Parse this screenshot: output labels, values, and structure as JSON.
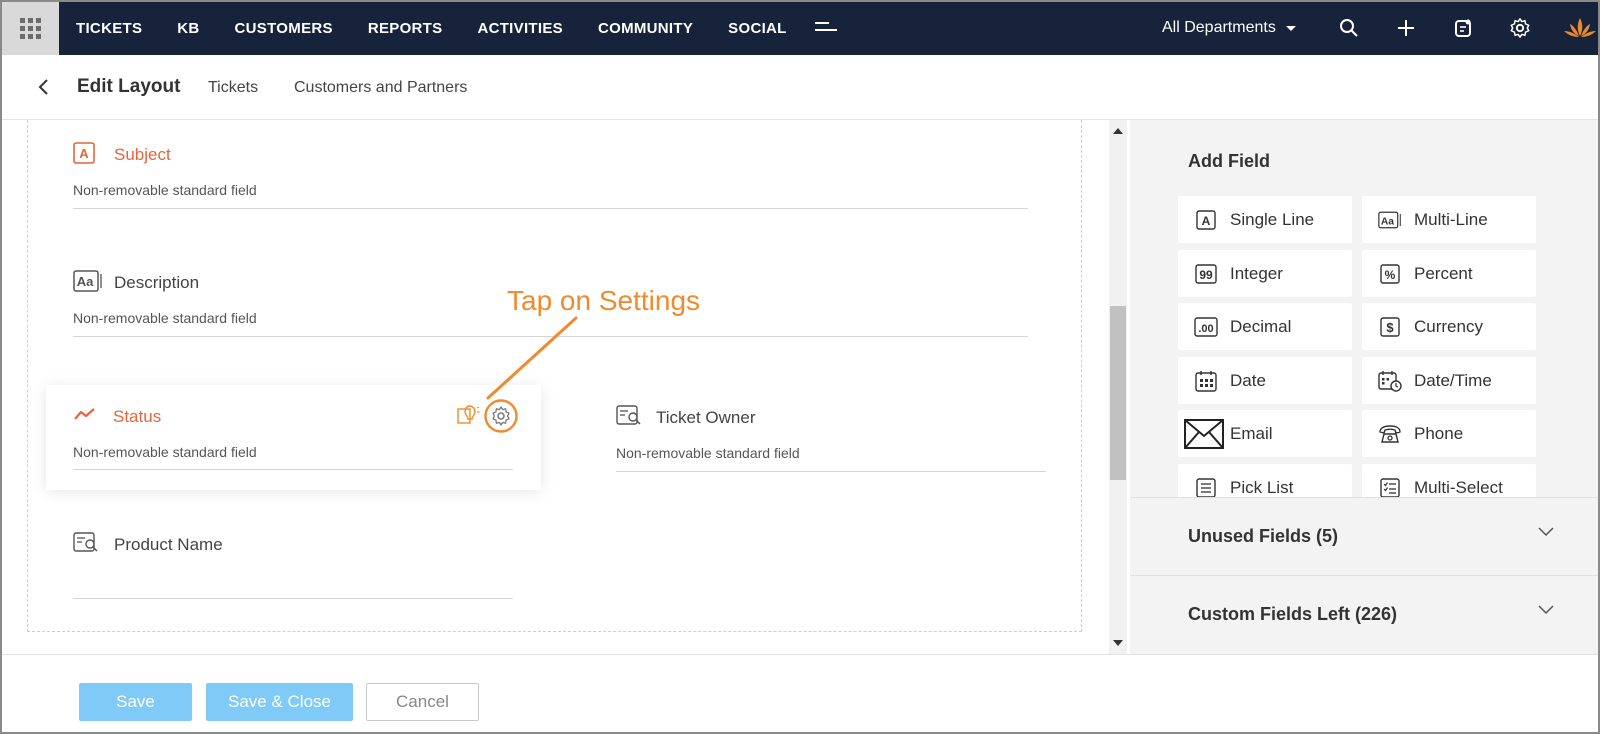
{
  "topnav": {
    "items": [
      "TICKETS",
      "KB",
      "CUSTOMERS",
      "REPORTS",
      "ACTIVITIES",
      "COMMUNITY",
      "SOCIAL"
    ],
    "department": "All Departments"
  },
  "subheader": {
    "title": "Edit Layout",
    "links": [
      "Tickets",
      "Customers and Partners"
    ]
  },
  "canvas": {
    "fields": {
      "subject": {
        "label": "Subject",
        "note": "Non-removable standard field"
      },
      "description": {
        "label": "Description",
        "note": "Non-removable standard field"
      },
      "status": {
        "label": "Status",
        "note": "Non-removable standard field"
      },
      "ticket_owner": {
        "label": "Ticket Owner",
        "note": "Non-removable standard field"
      },
      "product_name": {
        "label": "Product Name"
      }
    },
    "annotation": "Tap on Settings"
  },
  "panel": {
    "title": "Add Field",
    "field_types": [
      "Single Line",
      "Multi-Line",
      "Integer",
      "Percent",
      "Decimal",
      "Currency",
      "Date",
      "Date/Time",
      "Email",
      "Phone",
      "Pick List",
      "Multi-Select"
    ],
    "unused_fields": {
      "label": "Unused Fields",
      "count": "(5)"
    },
    "custom_fields_left": {
      "label": "Custom Fields Left",
      "count": "(226)"
    }
  },
  "footer": {
    "save": "Save",
    "save_close": "Save & Close",
    "cancel": "Cancel"
  },
  "colors": {
    "nav_bg": "#17233b",
    "accent_orange": "#e8643b",
    "annotation_orange": "#f08a2e",
    "primary_button": "#7fcaf7"
  }
}
